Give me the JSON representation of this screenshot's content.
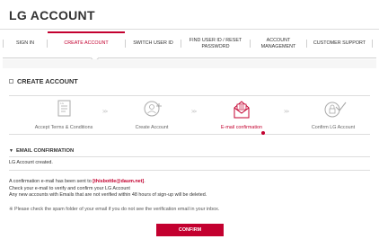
{
  "header": {
    "brand": "LG ACCOUNT"
  },
  "nav": [
    {
      "label": "SIGN IN",
      "active": false
    },
    {
      "label": "CREATE ACCOUNT",
      "active": true
    },
    {
      "label": "SWITCH USER ID",
      "active": false
    },
    {
      "label": "FIND USER ID / RESET\nPASSWORD",
      "active": false
    },
    {
      "label": "ACCOUNT\nMANAGEMENT",
      "active": false
    },
    {
      "label": "CUSTOMER SUPPORT",
      "active": false
    }
  ],
  "section": {
    "title": "CREATE ACCOUNT"
  },
  "steps": [
    {
      "label": "Accept Terms & Conditions",
      "icon": "terms-document-icon",
      "active": false
    },
    {
      "label": "Create Account",
      "icon": "user-add-icon",
      "active": false
    },
    {
      "label": "E-mail confirmation",
      "icon": "email-envelope-icon",
      "active": true
    },
    {
      "label": "Confirm LG Account",
      "icon": "lock-check-icon",
      "active": false
    }
  ],
  "step_separator": ">>",
  "email_confirmation": {
    "title": "EMAIL CONFIRMATION",
    "created": "LG Account created.",
    "sent_prefix": "A confirmation e-mail has been sent to ",
    "email": "[thisbottle@daum.net]",
    "sent_suffix": ".",
    "check": "Check your e-mail to verify and confirm your LG Account",
    "warning": "Any new accounts with Emails that are not verified within 48 hours of sign-up will be deleted.",
    "note": "※ Please check the spam folder of your email if you do not see the verification email in your inbox."
  },
  "confirm_button": {
    "label": "CONFIRM"
  },
  "colors": {
    "accent": "#c3002f",
    "text": "#333333",
    "border": "#dddddd"
  }
}
